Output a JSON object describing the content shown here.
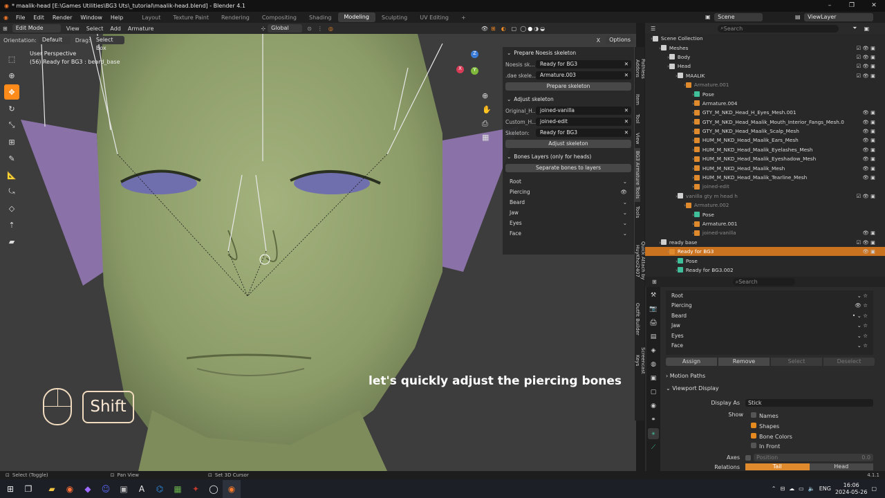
{
  "window": {
    "title": "* maalik-head [E:\\Games Utilities\\BG3 Uts\\_tutorial\\maalik-head.blend] - Blender 4.1",
    "controls": [
      "–",
      "❐",
      "✕"
    ]
  },
  "menu": {
    "items": [
      "File",
      "Edit",
      "Render",
      "Window",
      "Help"
    ],
    "workspaces": [
      "Layout",
      "Texture Paint",
      "Rendering",
      "Compositing",
      "Shading",
      "Modeling",
      "Sculpting",
      "UV Editing"
    ],
    "active_workspace": "Modeling",
    "add_tab": "+",
    "scene_label": "Scene",
    "viewlayer_label": "ViewLayer"
  },
  "header": {
    "mode": "Edit Mode",
    "items": [
      "View",
      "Select",
      "Add",
      "Armature"
    ],
    "transform_orientation": "Global",
    "orientation_label": "Orientation:",
    "orientation_value": "Default",
    "drag_label": "Drag:",
    "drag_value": "Select Box",
    "options_label": "Options"
  },
  "viewport": {
    "perspective": "User Perspective",
    "object_info": "(56) Ready for BG3 : beard_base",
    "caption": "let's quickly adjust the piercing bones",
    "key_hint": "Shift",
    "gizmo_axes": [
      "Z",
      "Y",
      "X"
    ]
  },
  "npanel": {
    "prepare": {
      "title": "Prepare Noesis skeleton",
      "noesis_label": "Noesis sk...",
      "noesis_value": "Ready for BG3",
      "dae_label": ".dae skele...",
      "dae_value": "Armature.003",
      "button": "Prepare skeleton"
    },
    "adjust": {
      "title": "Adjust skeleton",
      "original_label": "Original_H...",
      "original_value": "joined-vanilla",
      "custom_label": "Custom_H...",
      "custom_value": "joined-edit",
      "skeleton_label": "Skeleton:",
      "skeleton_value": "Ready for BG3",
      "button": "Adjust skeleton"
    },
    "layers": {
      "title": "Bones Layers (only for heads)",
      "button": "Separate bones to layers",
      "items": [
        "Root",
        "Piercing",
        "Beard",
        "Jaw",
        "Eyes",
        "Face"
      ]
    },
    "tabs": [
      "Pathless Addons",
      "Item",
      "Tool",
      "View",
      "BG3 Armature Tools",
      "Tools",
      "Quick Attach by HuyKhoi2407",
      "Outfit Builder",
      "Screencast Keys"
    ]
  },
  "outliner": {
    "search_placeholder": "Search",
    "rows": [
      {
        "text": "Scene Collection",
        "indent": 0,
        "dim": false,
        "sel": false,
        "color": "#cfcfcf",
        "right": ""
      },
      {
        "text": "Meshes",
        "indent": 1,
        "dim": false,
        "sel": false,
        "color": "#cfcfcf",
        "right": "☑ 👁 ▣"
      },
      {
        "text": "Body",
        "indent": 2,
        "dim": false,
        "sel": false,
        "color": "#cfcfcf",
        "right": "☑ 👁 ▣"
      },
      {
        "text": "Head",
        "indent": 2,
        "dim": false,
        "sel": false,
        "color": "#cfcfcf",
        "right": "☑ 👁 ▣"
      },
      {
        "text": "MAALIK",
        "indent": 3,
        "dim": false,
        "sel": false,
        "color": "#cfcfcf",
        "right": "☑ 👁 ▣"
      },
      {
        "text": "Armature.001",
        "indent": 4,
        "dim": true,
        "sel": false,
        "color": "#e08a2e",
        "right": ""
      },
      {
        "text": "Pose",
        "indent": 5,
        "dim": false,
        "sel": false,
        "color": "#3fbf9a",
        "right": ""
      },
      {
        "text": "Armature.004",
        "indent": 5,
        "dim": false,
        "sel": false,
        "color": "#e08a2e",
        "right": ""
      },
      {
        "text": "GTY_M_NKD_Head_H_Eyes_Mesh.001",
        "indent": 5,
        "dim": false,
        "sel": false,
        "color": "#e08a2e",
        "right": "👁 ▣"
      },
      {
        "text": "GTY_M_NKD_Head_Maalik_Mouth_Interior_Fangs_Mesh.0",
        "indent": 5,
        "dim": false,
        "sel": false,
        "color": "#e08a2e",
        "right": "👁 ▣"
      },
      {
        "text": "GTY_M_NKD_Head_Maalik_Scalp_Mesh",
        "indent": 5,
        "dim": false,
        "sel": false,
        "color": "#e08a2e",
        "right": "👁 ▣"
      },
      {
        "text": "HUM_M_NKD_Head_Maalik_Ears_Mesh",
        "indent": 5,
        "dim": false,
        "sel": false,
        "color": "#e08a2e",
        "right": "👁 ▣"
      },
      {
        "text": "HUM_M_NKD_Head_Maalik_Eyelashes_Mesh",
        "indent": 5,
        "dim": false,
        "sel": false,
        "color": "#e08a2e",
        "right": "👁 ▣"
      },
      {
        "text": "HUM_M_NKD_Head_Maalik_Eyeshadow_Mesh",
        "indent": 5,
        "dim": false,
        "sel": false,
        "color": "#e08a2e",
        "right": "👁 ▣"
      },
      {
        "text": "HUM_M_NKD_Head_Maalik_Mesh",
        "indent": 5,
        "dim": false,
        "sel": false,
        "color": "#e08a2e",
        "right": "👁 ▣"
      },
      {
        "text": "HUM_M_NKD_Head_Maalik_Tearline_Mesh",
        "indent": 5,
        "dim": false,
        "sel": false,
        "color": "#e08a2e",
        "right": "👁 ▣"
      },
      {
        "text": "joined-edit",
        "indent": 5,
        "dim": true,
        "sel": false,
        "color": "#e08a2e",
        "right": ""
      },
      {
        "text": "vanilla gty m head h",
        "indent": 3,
        "dim": true,
        "sel": false,
        "color": "#cfcfcf",
        "right": "☑ 👁 ▣"
      },
      {
        "text": "Armature.002",
        "indent": 4,
        "dim": true,
        "sel": false,
        "color": "#e08a2e",
        "right": ""
      },
      {
        "text": "Pose",
        "indent": 5,
        "dim": false,
        "sel": false,
        "color": "#3fbf9a",
        "right": ""
      },
      {
        "text": "Armature.001",
        "indent": 5,
        "dim": false,
        "sel": false,
        "color": "#e08a2e",
        "right": ""
      },
      {
        "text": "joined-vanilla",
        "indent": 5,
        "dim": true,
        "sel": false,
        "color": "#e08a2e",
        "right": "👁 ▣"
      },
      {
        "text": "ready base",
        "indent": 1,
        "dim": false,
        "sel": false,
        "color": "#cfcfcf",
        "right": "☑ 👁 ▣"
      },
      {
        "text": "Ready for BG3",
        "indent": 2,
        "dim": false,
        "sel": true,
        "color": "#e08a2e",
        "right": "👁 ▣"
      },
      {
        "text": "Pose",
        "indent": 3,
        "dim": false,
        "sel": false,
        "color": "#3fbf9a",
        "right": ""
      },
      {
        "text": "Ready for BG3.002",
        "indent": 3,
        "dim": false,
        "sel": false,
        "color": "#3fbf9a",
        "right": ""
      }
    ]
  },
  "properties": {
    "search_placeholder": "Search",
    "groups": [
      "Root",
      "Piercing",
      "Beard",
      "Jaw",
      "Eyes",
      "Face"
    ],
    "buttons": {
      "assign": "Assign",
      "remove": "Remove",
      "select": "Select",
      "deselect": "Deselect"
    },
    "motion_paths": "Motion Paths",
    "viewport_display": "Viewport Display",
    "display_as_label": "Display As",
    "display_as_value": "Stick",
    "show_label": "Show",
    "show_items": [
      {
        "label": "Names",
        "checked": false
      },
      {
        "label": "Shapes",
        "checked": true
      },
      {
        "label": "Bone Colors",
        "checked": true
      },
      {
        "label": "In Front",
        "checked": false
      }
    ],
    "axes_label": "Axes",
    "position_label": "Position",
    "position_value": "0.0",
    "relations_label": "Relations",
    "tail_label": "Tail",
    "head_label": "Head"
  },
  "status": {
    "select": "Select (Toggle)",
    "pan": "Pan View",
    "cursor": "Set 3D Cursor",
    "version": "4.1.1"
  },
  "taskbar": {
    "lang": "ENG",
    "time": "16:06",
    "date": "2024-05-26"
  }
}
